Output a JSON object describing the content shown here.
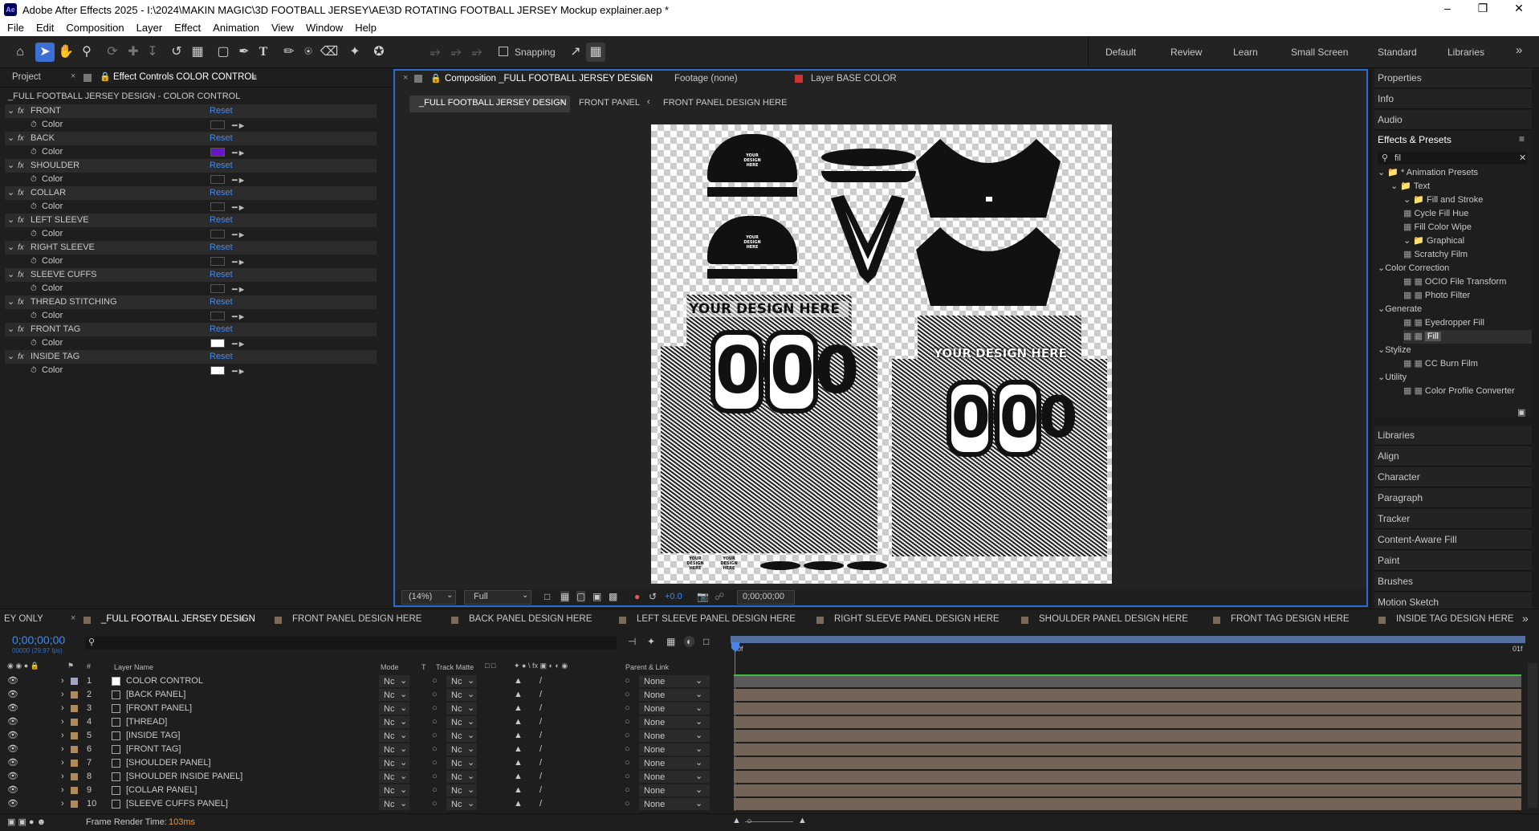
{
  "window": {
    "title": "Adobe After Effects 2025 - I:\\2024\\MAKIN MAGIC\\3D FOOTBALL JERSEY\\AE\\3D ROTATING FOOTBALL JERSEY Mockup explainer.aep *",
    "logo": "Ae"
  },
  "menu": [
    "File",
    "Edit",
    "Composition",
    "Layer",
    "Effect",
    "Animation",
    "View",
    "Window",
    "Help"
  ],
  "toolbar": {
    "snapping": "Snapping",
    "workspaces": [
      "Default",
      "Review",
      "Learn",
      "Small Screen",
      "Standard",
      "Libraries"
    ]
  },
  "left": {
    "project_tab": "Project",
    "effect_tab": "Effect Controls COLOR CONTROL",
    "header": "_FULL FOOTBALL JERSEY DESIGN - COLOR CONTROL",
    "reset_label": "Reset",
    "color_label": "Color",
    "effects": [
      {
        "name": "FRONT",
        "color": "#1e1e1e"
      },
      {
        "name": "BACK",
        "color": "#6a12d0"
      },
      {
        "name": "SHOULDER",
        "color": "#1e1e1e"
      },
      {
        "name": "COLLAR",
        "color": "#1e1e1e"
      },
      {
        "name": "LEFT SLEEVE",
        "color": "#1e1e1e"
      },
      {
        "name": "RIGHT SLEEVE",
        "color": "#1e1e1e"
      },
      {
        "name": "SLEEVE CUFFS",
        "color": "#1e1e1e"
      },
      {
        "name": "THREAD STITCHING",
        "color": "#1e1e1e"
      },
      {
        "name": "FRONT TAG",
        "color": "#ffffff"
      },
      {
        "name": "INSIDE TAG",
        "color": "#ffffff"
      }
    ]
  },
  "comp": {
    "tab": "Composition _FULL FOOTBALL JERSEY DESIGN",
    "footage_tab": "Footage (none)",
    "layer_tab": "Layer BASE COLOR",
    "crumbs": [
      "_FULL FOOTBALL JERSEY DESIGN",
      "FRONT PANEL",
      "FRONT PANEL DESIGN HERE"
    ],
    "zoom": "(14%)",
    "resolution": "Full",
    "exposure": "+0.0",
    "timecode": "0;00;00;00",
    "art": {
      "design_text": "YOUR DESIGN HERE",
      "number": "00",
      "small_text": "YOUR DESIGN HERE"
    }
  },
  "right": {
    "top_items": [
      "Properties",
      "Info",
      "Audio"
    ],
    "effects_presets": "Effects & Presets",
    "search_value": "fil",
    "tree": [
      {
        "label": "* Animation Presets",
        "indent": 0,
        "type": "folder-open"
      },
      {
        "label": "Text",
        "indent": 1,
        "type": "folder-open"
      },
      {
        "label": "Fill and Stroke",
        "indent": 2,
        "type": "folder-open"
      },
      {
        "label": "Cycle Fill Hue",
        "indent": 3,
        "type": "preset"
      },
      {
        "label": "Fill Color Wipe",
        "indent": 3,
        "type": "preset"
      },
      {
        "label": "Graphical",
        "indent": 2,
        "type": "folder-open"
      },
      {
        "label": "Scratchy Film",
        "indent": 3,
        "type": "preset"
      },
      {
        "label": "Color Correction",
        "indent": 0,
        "type": "category"
      },
      {
        "label": "OCIO File Transform",
        "indent": 2,
        "type": "effect"
      },
      {
        "label": "Photo Filter",
        "indent": 2,
        "type": "effect"
      },
      {
        "label": "Generate",
        "indent": 0,
        "type": "category"
      },
      {
        "label": "Eyedropper Fill",
        "indent": 2,
        "type": "effect"
      },
      {
        "label": "Fill",
        "indent": 2,
        "type": "effect-selected"
      },
      {
        "label": "Stylize",
        "indent": 0,
        "type": "category"
      },
      {
        "label": "CC Burn Film",
        "indent": 2,
        "type": "effect"
      },
      {
        "label": "Utility",
        "indent": 0,
        "type": "category"
      },
      {
        "label": "Color Profile Converter",
        "indent": 2,
        "type": "effect"
      }
    ],
    "bottom_items": [
      "Libraries",
      "Align",
      "Character",
      "Paragraph",
      "Tracker",
      "Content-Aware Fill",
      "Paint",
      "Brushes",
      "Motion Sketch"
    ]
  },
  "timeline": {
    "tabs": [
      "EY ONLY",
      "_FULL FOOTBALL JERSEY DESIGN",
      "FRONT PANEL DESIGN HERE",
      "BACK PANEL DESIGN HERE",
      "LEFT SLEEVE PANEL DESIGN HERE",
      "RIGHT SLEEVE PANEL DESIGN HERE",
      "SHOULDER PANEL DESIGN HERE",
      "FRONT TAG DESIGN HERE",
      "INSIDE TAG DESIGN HERE"
    ],
    "timecode": "0;00;00;00",
    "fps": "00000 (29.97 fps)",
    "columns": {
      "layer_name": "Layer Name",
      "mode": "Mode",
      "t": "T",
      "track_matte": "Track Matte",
      "parent": "Parent & Link"
    },
    "ruler_start": "0f",
    "ruler_end": "01f",
    "mode_value": "Nc",
    "matte_value": "Nc",
    "parent_value": "None",
    "layers": [
      {
        "num": "1",
        "name": "COLOR CONTROL",
        "label": "#a3a3c2"
      },
      {
        "num": "2",
        "name": "[BACK PANEL]",
        "label": "#b08a5f"
      },
      {
        "num": "3",
        "name": "[FRONT PANEL]",
        "label": "#b08a5f"
      },
      {
        "num": "4",
        "name": "[THREAD]",
        "label": "#b08a5f"
      },
      {
        "num": "5",
        "name": "[INSIDE TAG]",
        "label": "#b08a5f"
      },
      {
        "num": "6",
        "name": "[FRONT TAG]",
        "label": "#b08a5f"
      },
      {
        "num": "7",
        "name": "[SHOULDER PANEL]",
        "label": "#b08a5f"
      },
      {
        "num": "8",
        "name": "[SHOULDER INSIDE PANEL]",
        "label": "#b08a5f"
      },
      {
        "num": "9",
        "name": "[COLLAR PANEL]",
        "label": "#b08a5f"
      },
      {
        "num": "10",
        "name": "[SLEEVE CUFFS PANEL]",
        "label": "#b08a5f"
      }
    ],
    "render_label": "Frame Render Time:",
    "render_value": "103ms"
  }
}
